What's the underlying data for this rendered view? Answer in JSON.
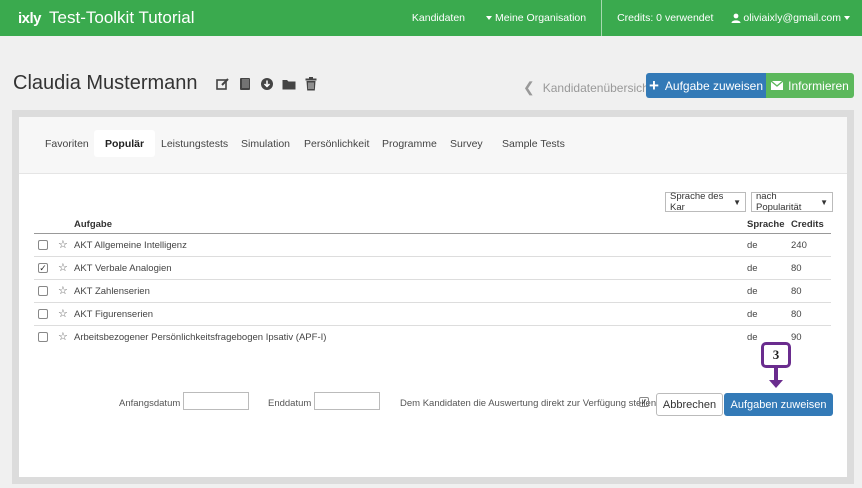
{
  "brand": {
    "logo": "ixly",
    "title": "Test-Toolkit Tutorial"
  },
  "nav": {
    "kandidaten": "Kandidaten",
    "organisation": "Meine Organisation",
    "credits": "Credits: 0 verwendet",
    "user": "oliviaixly@gmail.com"
  },
  "header": {
    "title": "Claudia Mustermann",
    "back_label": "Kandidatenübersicht",
    "assign_label": "Aufgabe zuweisen",
    "inform_label": "Informieren"
  },
  "tabs": [
    "Favoriten",
    "Populär",
    "Leistungstests",
    "Simulation",
    "Persönlichkeit",
    "Programme",
    "Survey",
    "Sample Tests"
  ],
  "active_tab": "Populär",
  "filters": {
    "language": "Sprache des Kar",
    "sort": "nach Popularität"
  },
  "table": {
    "headers": {
      "task": "Aufgabe",
      "language": "Sprache",
      "credits": "Credits"
    },
    "rows": [
      {
        "name": "AKT Allgemeine Intelligenz",
        "lang": "de",
        "credits": "240",
        "checked": false
      },
      {
        "name": "AKT Verbale Analogien",
        "lang": "de",
        "credits": "80",
        "checked": true
      },
      {
        "name": "AKT Zahlenserien",
        "lang": "de",
        "credits": "80",
        "checked": false
      },
      {
        "name": "AKT Figurenserien",
        "lang": "de",
        "credits": "80",
        "checked": false
      },
      {
        "name": "Arbeitsbezogener Persönlichkeitsfragebogen Ipsativ (APF-I)",
        "lang": "de",
        "credits": "90",
        "checked": false
      }
    ]
  },
  "footer": {
    "start_label": "Anfangsdatum",
    "end_label": "Enddatum",
    "share_label": "Dem Kandidaten die Auswertung direkt zur Verfügung stellen",
    "share_checked": true,
    "cancel_label": "Abbrechen",
    "submit_label": "Aufgaben zuweisen"
  },
  "callout": {
    "step": "3"
  },
  "colors": {
    "topbar": "#3aaa4e",
    "primary": "#337ab7",
    "success": "#5cb85c",
    "callout": "#6a2c8e"
  }
}
